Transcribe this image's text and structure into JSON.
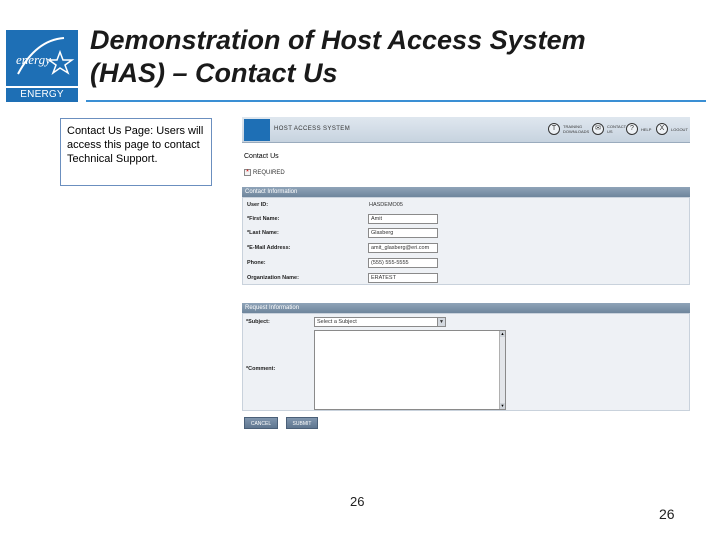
{
  "slide": {
    "title_line1": "Demonstration of Host Access System",
    "title_line2": "(HAS) – Contact Us",
    "logo_text": "ENERGY STAR",
    "logo_script": "energy",
    "callout": "Contact Us Page:  Users will access this page to contact Technical Support.",
    "page_number_mid": "26",
    "page_number": "26"
  },
  "app": {
    "title": "HOST ACCESS SYSTEM",
    "header_links": [
      {
        "icon": "T",
        "icon_name": "training-icon",
        "label": "TRAINING DOWNLOADS"
      },
      {
        "icon": "✉",
        "icon_name": "mail-icon",
        "label": "CONTACT US"
      },
      {
        "icon": "?",
        "icon_name": "help-icon",
        "label": "HELP"
      },
      {
        "icon": "X",
        "icon_name": "logout-icon",
        "label": "LOGOUT"
      }
    ],
    "page_heading": "Contact Us",
    "required_label": "REQUIRED",
    "required_mark": "*",
    "contact_section": "Contact Information",
    "fields": {
      "user_id": {
        "label": "User ID:",
        "value": "HASDEMO05"
      },
      "first_name": {
        "label": "*First Name:",
        "value": "Amit"
      },
      "last_name": {
        "label": "*Last Name:",
        "value": "Glasberg"
      },
      "email": {
        "label": "*E-Mail Address:",
        "value": "amit_glasberg@eri.com"
      },
      "phone": {
        "label": "Phone:",
        "value": "(555) 555-5555"
      },
      "organization": {
        "label": "Organization Name:",
        "value": "ERATEST"
      }
    },
    "request_section": "Request Information",
    "subject_label": "*Subject:",
    "subject_value": "Select a Subject",
    "comment_label": "*Comment:",
    "cancel_button": "CANCEL",
    "submit_button": "SUBMIT"
  }
}
